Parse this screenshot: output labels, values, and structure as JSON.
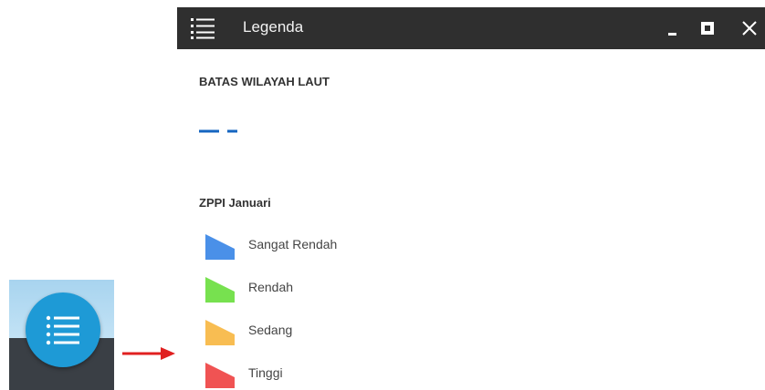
{
  "window": {
    "title": "Legenda",
    "titlebar_color": "#2f2f2f"
  },
  "sections": {
    "batas": {
      "title": "BATAS WILAYAH LAUT",
      "line_color": "#1565c0",
      "line_style": "dashed"
    },
    "zppi": {
      "title": "ZPPI Januari",
      "items": [
        {
          "label": "Sangat Rendah",
          "color": "#4a90e8"
        },
        {
          "label": "Rendah",
          "color": "#77e14f"
        },
        {
          "label": "Sedang",
          "color": "#f8bd52"
        },
        {
          "label": "Tinggi",
          "color": "#f05353"
        }
      ]
    }
  },
  "launcher": {
    "icon": "legend-list-icon",
    "button_color": "#1e9ad6",
    "arrow_color": "#e02020"
  },
  "icons": {
    "titlebar_left": "list-icon",
    "minimize": "minimize-icon",
    "maximize": "maximize-icon",
    "close": "close-icon"
  }
}
